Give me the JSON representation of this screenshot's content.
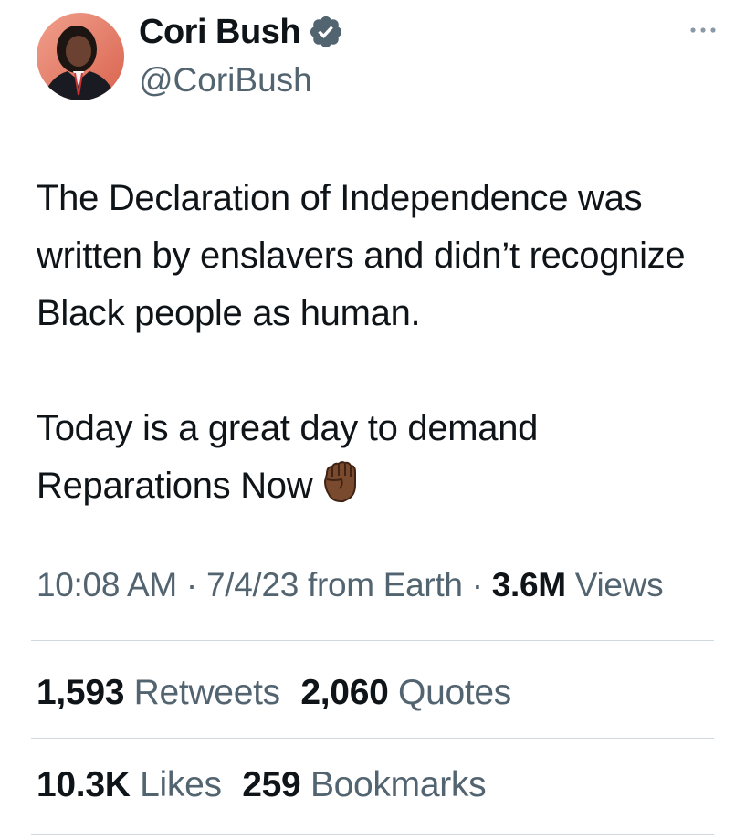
{
  "author": {
    "display_name": "Cori Bush",
    "handle": "@CoriBush",
    "verified_icon": "verified-badge-icon",
    "verified_color": "#536471"
  },
  "more_icon": "more-options-icon",
  "tweet": {
    "paragraphs": [
      "The Declaration of Independence was written by enslavers and didn’t recognize Black people as human.",
      "Today is a great day to demand Reparations Now"
    ],
    "emoji": "raised-fist-medium-dark-skin-tone"
  },
  "meta": {
    "time": "10:08 AM",
    "date": "7/4/23",
    "source": "from Earth",
    "views_count": "3.6M",
    "views_label": "Views",
    "separator": "·"
  },
  "stats": {
    "retweets_count": "1,593",
    "retweets_label": "Retweets",
    "quotes_count": "2,060",
    "quotes_label": "Quotes",
    "likes_count": "10.3K",
    "likes_label": "Likes",
    "bookmarks_count": "259",
    "bookmarks_label": "Bookmarks"
  },
  "colors": {
    "text_primary": "#0f1419",
    "text_secondary": "#536471",
    "divider": "#cfd9de",
    "avatar_bg": "#e8836f"
  }
}
